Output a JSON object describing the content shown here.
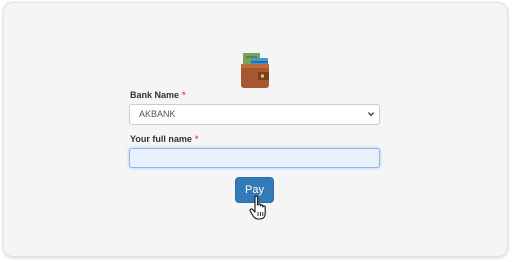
{
  "form": {
    "bank_label": "Bank Name",
    "name_label": "Your full name",
    "required_mark": "*",
    "bank_value": "AKBANK",
    "name_value": "",
    "pay_label": "Pay"
  },
  "icons": {
    "wallet": "wallet-icon",
    "dropdown": "chevron-down-icon",
    "cursor": "hand-cursor-icon"
  },
  "colors": {
    "primary_button": "#337ab7",
    "required": "#d9534f",
    "input_focus_bg": "#e8f0fe"
  }
}
